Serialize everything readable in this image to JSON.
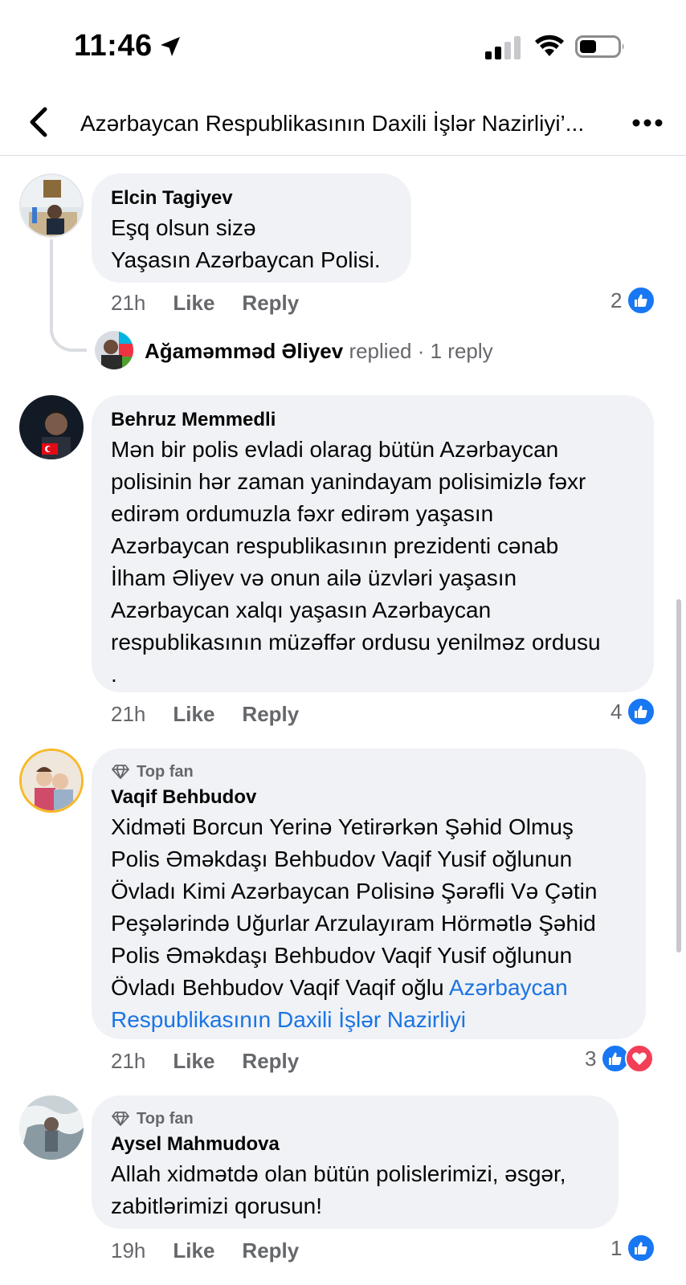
{
  "status_bar": {
    "time": "11:46"
  },
  "header": {
    "title": "Azərbaycan Respublikasının Daxili İşlər Nazirliyi’..."
  },
  "comments": [
    {
      "author": "Elcin Tagiyev",
      "lines": [
        "Eşq olsun sizə",
        "Yaşasın Azərbaycan Polisi."
      ],
      "time": "21h",
      "like_label": "Like",
      "reply_label": "Reply",
      "reaction_count": "2",
      "reactions": [
        "like"
      ],
      "reply_summary": {
        "name": "Ağaməmməd Əliyev",
        "replied": "replied",
        "count": "· 1 reply"
      }
    },
    {
      "author": "Behruz Memmedli",
      "lines": [
        "Mən bir polis evladi olarag bütün Azərbaycan",
        "polisinin hər zaman yanindayam polisimizlə fəxr",
        "edirəm ordumuzla fəxr edirəm yaşasın",
        "Azərbaycan respublikasının prezidenti cənab",
        "İlham Əliyev və onun ailə üzvləri yaşasın",
        "Azərbaycan xalqı yaşasın Azərbaycan",
        "respublikasının müzəffər ordusu yenilməz ordusu",
        "."
      ],
      "time": "21h",
      "like_label": "Like",
      "reply_label": "Reply",
      "reaction_count": "4",
      "reactions": [
        "like"
      ]
    },
    {
      "badge": "Top fan",
      "author": "Vaqif Behbudov",
      "lines": [
        "Xidməti Borcun Yerinə Yetirərkən Şəhid Olmuş",
        "Polis Əməkdaşı Behbudov Vaqif Yusif oğlunun",
        "Övladı Kimi Azərbaycan Polisinə Şərəfli Və Çətin",
        "Peşələrində Uğurlar Arzulayıram Hörmətlə Şəhid",
        "Polis Əməkdaşı Behbudov Vaqif Yusif oğlunun"
      ],
      "last_line_plain": "Övladı Behbudov Vaqif Vaqif oğlu ",
      "last_line_link": "Azərbaycan",
      "link_line": "Respublikasının Daxili İşlər Nazirliyi",
      "time": "21h",
      "like_label": "Like",
      "reply_label": "Reply",
      "reaction_count": "3",
      "reactions": [
        "like",
        "love"
      ]
    },
    {
      "badge": "Top fan",
      "author": "Aysel Mahmudova",
      "lines": [
        "Allah xidmətdə olan bütün polislerimizi, əsgər,",
        "zabitlərimizi qorusun!"
      ],
      "time": "19h",
      "like_label": "Like",
      "reply_label": "Reply",
      "reaction_count": "1",
      "reactions": [
        "like"
      ]
    }
  ],
  "colors": {
    "bubble": "#f0f2f5",
    "link": "#1b74e4",
    "like": "#1877f2",
    "love": "#f33e58",
    "muted": "#65676b"
  },
  "icons": [
    "location-arrow-icon",
    "cellular-signal-icon",
    "wifi-icon",
    "battery-icon",
    "back-chevron-icon",
    "more-dots-icon",
    "diamond-icon",
    "thumbs-up-icon",
    "heart-icon"
  ]
}
